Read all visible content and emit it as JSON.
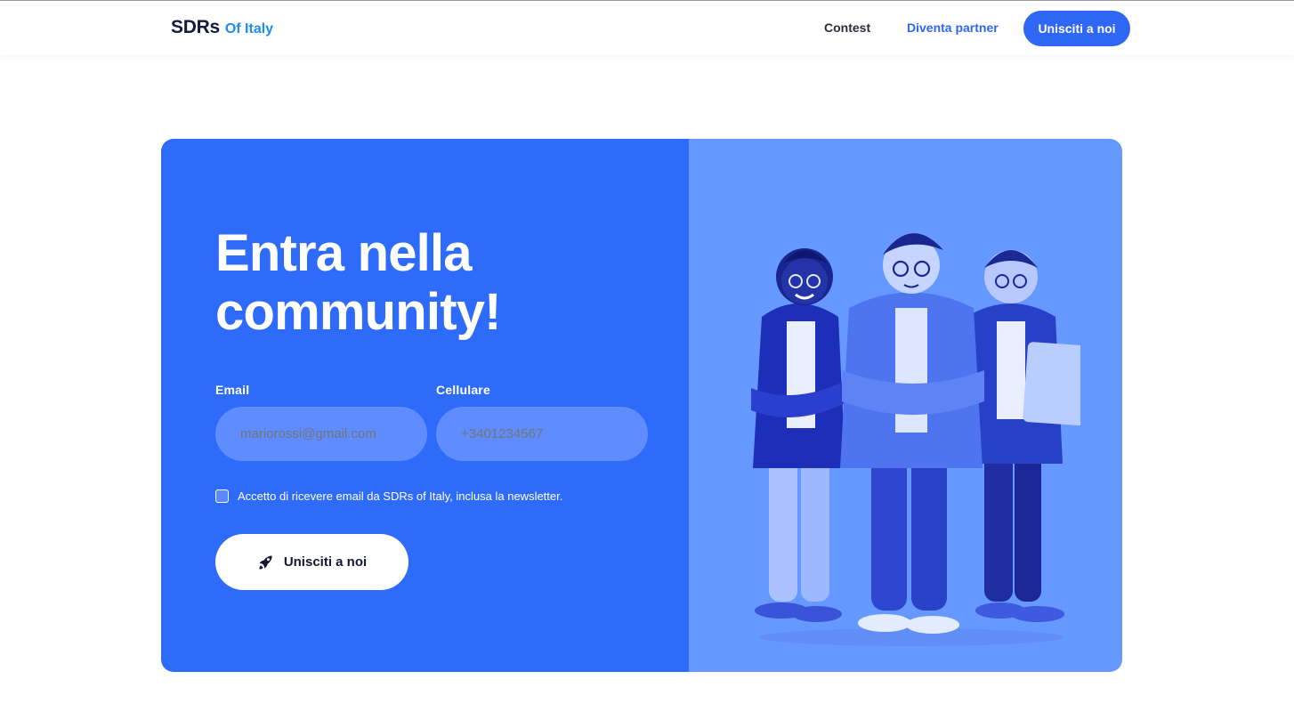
{
  "header": {
    "logo_main": "SDRs",
    "logo_sub": "Of Italy",
    "nav": {
      "contest": "Contest",
      "partner": "Diventa partner",
      "cta": "Unisciti a noi"
    }
  },
  "form": {
    "headline": "Entra nella community!",
    "email_label": "Email",
    "email_placeholder": "mariorossi@gmail.com",
    "phone_label": "Cellulare",
    "phone_placeholder": "+3401234567",
    "consent": "Accetto di ricevere email da SDRs of Italy, inclusa la newsletter.",
    "consent_checked": false,
    "submit_label": "Unisciti a noi",
    "submit_icon": "rocket-icon"
  },
  "illustration": {
    "subject": "three-people-illustration"
  },
  "colors": {
    "brand_blue": "#2f67f5",
    "card_left": "#2f6bfb",
    "card_right": "#6699ff",
    "logo_accent": "#1d8cf0"
  }
}
